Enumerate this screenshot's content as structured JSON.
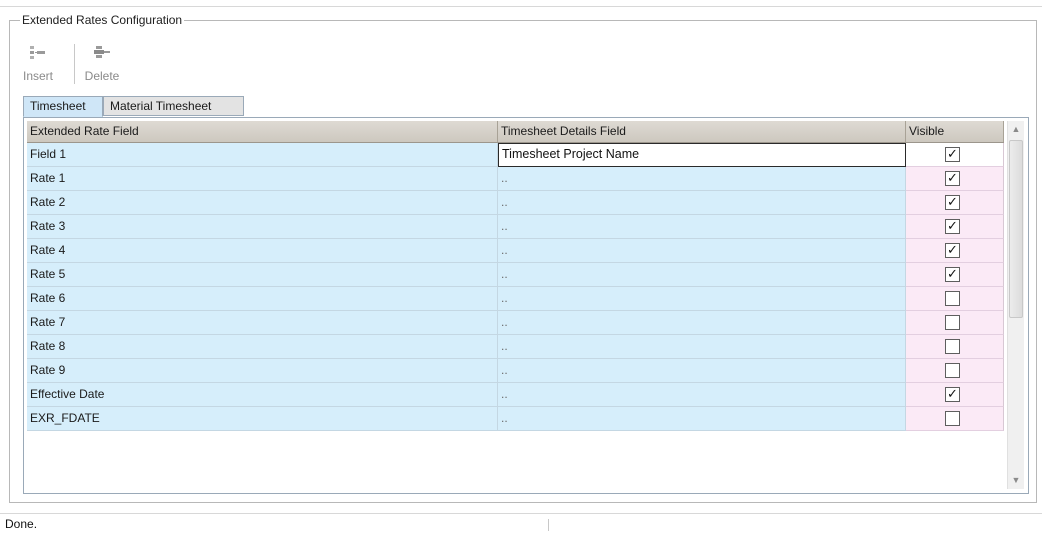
{
  "groupbox": {
    "title": "Extended Rates Configuration"
  },
  "toolbar": {
    "insert_label": "Insert",
    "delete_label": "Delete",
    "insert_icon": "insert-row-icon",
    "delete_icon": "delete-row-icon"
  },
  "tabs": [
    {
      "label": "Timesheet",
      "active": true
    },
    {
      "label": "Material Timesheet",
      "active": false
    }
  ],
  "grid": {
    "columns": [
      "Extended Rate Field",
      "Timesheet Details Field",
      "Visible"
    ],
    "rows": [
      {
        "field": "Field 1",
        "details": "Timesheet Project Name",
        "visible": true
      },
      {
        "field": "Rate 1",
        "details": "..",
        "visible": true
      },
      {
        "field": "Rate 2",
        "details": "..",
        "visible": true
      },
      {
        "field": "Rate 3",
        "details": "..",
        "visible": true
      },
      {
        "field": "Rate 4",
        "details": "..",
        "visible": true
      },
      {
        "field": "Rate 5",
        "details": "..",
        "visible": true
      },
      {
        "field": "Rate 6",
        "details": "..",
        "visible": false
      },
      {
        "field": "Rate 7",
        "details": "..",
        "visible": false
      },
      {
        "field": "Rate 8",
        "details": "..",
        "visible": false
      },
      {
        "field": "Rate 9",
        "details": "..",
        "visible": false
      },
      {
        "field": "Effective Date",
        "details": "..",
        "visible": true
      },
      {
        "field": "EXR_FDATE",
        "details": "..",
        "visible": false
      }
    ]
  },
  "colors": {
    "row_bg": "#d6eefb",
    "visible_bg": "#fbeaf6",
    "header_bg": "#d5d0c8",
    "active_tab_bg": "#cfe6f7"
  },
  "status": {
    "text": "Done."
  }
}
